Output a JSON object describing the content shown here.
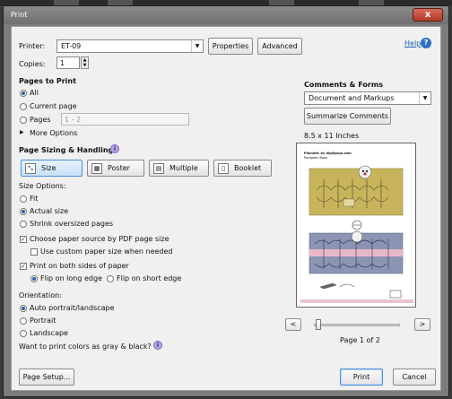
{
  "window": {
    "title": "Print",
    "close_glyph": "x"
  },
  "help": {
    "label": "Help"
  },
  "printer": {
    "label": "Printer:",
    "value": "ET-09",
    "properties": "Properties",
    "advanced": "Advanced"
  },
  "copies": {
    "label": "Copies:",
    "value": "1"
  },
  "pages_to_print": {
    "heading": "Pages to Print",
    "all": "All",
    "current_page": "Current page",
    "pages": "Pages",
    "pages_range_placeholder": "1 - 2",
    "more_options": "More Options"
  },
  "sizing": {
    "heading": "Page Sizing & Handling",
    "tabs": [
      "Size",
      "Poster",
      "Multiple",
      "Booklet"
    ],
    "size_options_label": "Size Options:",
    "fit": "Fit",
    "actual_size": "Actual size",
    "shrink": "Shrink oversized pages",
    "choose_source": "Choose paper source by PDF page size",
    "custom_paper": "Use custom paper size when needed",
    "print_both_sides": "Print on both sides of paper",
    "flip_long": "Flip on long edge",
    "flip_short": "Flip on short edge"
  },
  "orientation": {
    "label": "Orientation:",
    "auto": "Auto portrait/landscape",
    "portrait": "Portrait",
    "landscape": "Landscape"
  },
  "gray_question": "Want to print colors as gray & black?",
  "comments_forms": {
    "heading": "Comments & Forms",
    "value": "Document and Markups",
    "summarize": "Summarize Comments"
  },
  "preview": {
    "paper_size": "8.5 x 11 Inches",
    "page_status": "Page 1 of 2",
    "doc_line1": "Phanatic by digitpapa.com",
    "doc_line2": "Paragami Book",
    "prev": "<",
    "next": ">",
    "page_position_fraction": 0.0
  },
  "footer": {
    "page_setup": "Page Setup...",
    "print": "Print",
    "cancel": "Cancel"
  },
  "colors": {
    "accent": "#4a8fd8",
    "link": "#1f5fb8",
    "mustard": "#c8b45a",
    "slate": "#8b95b3"
  }
}
